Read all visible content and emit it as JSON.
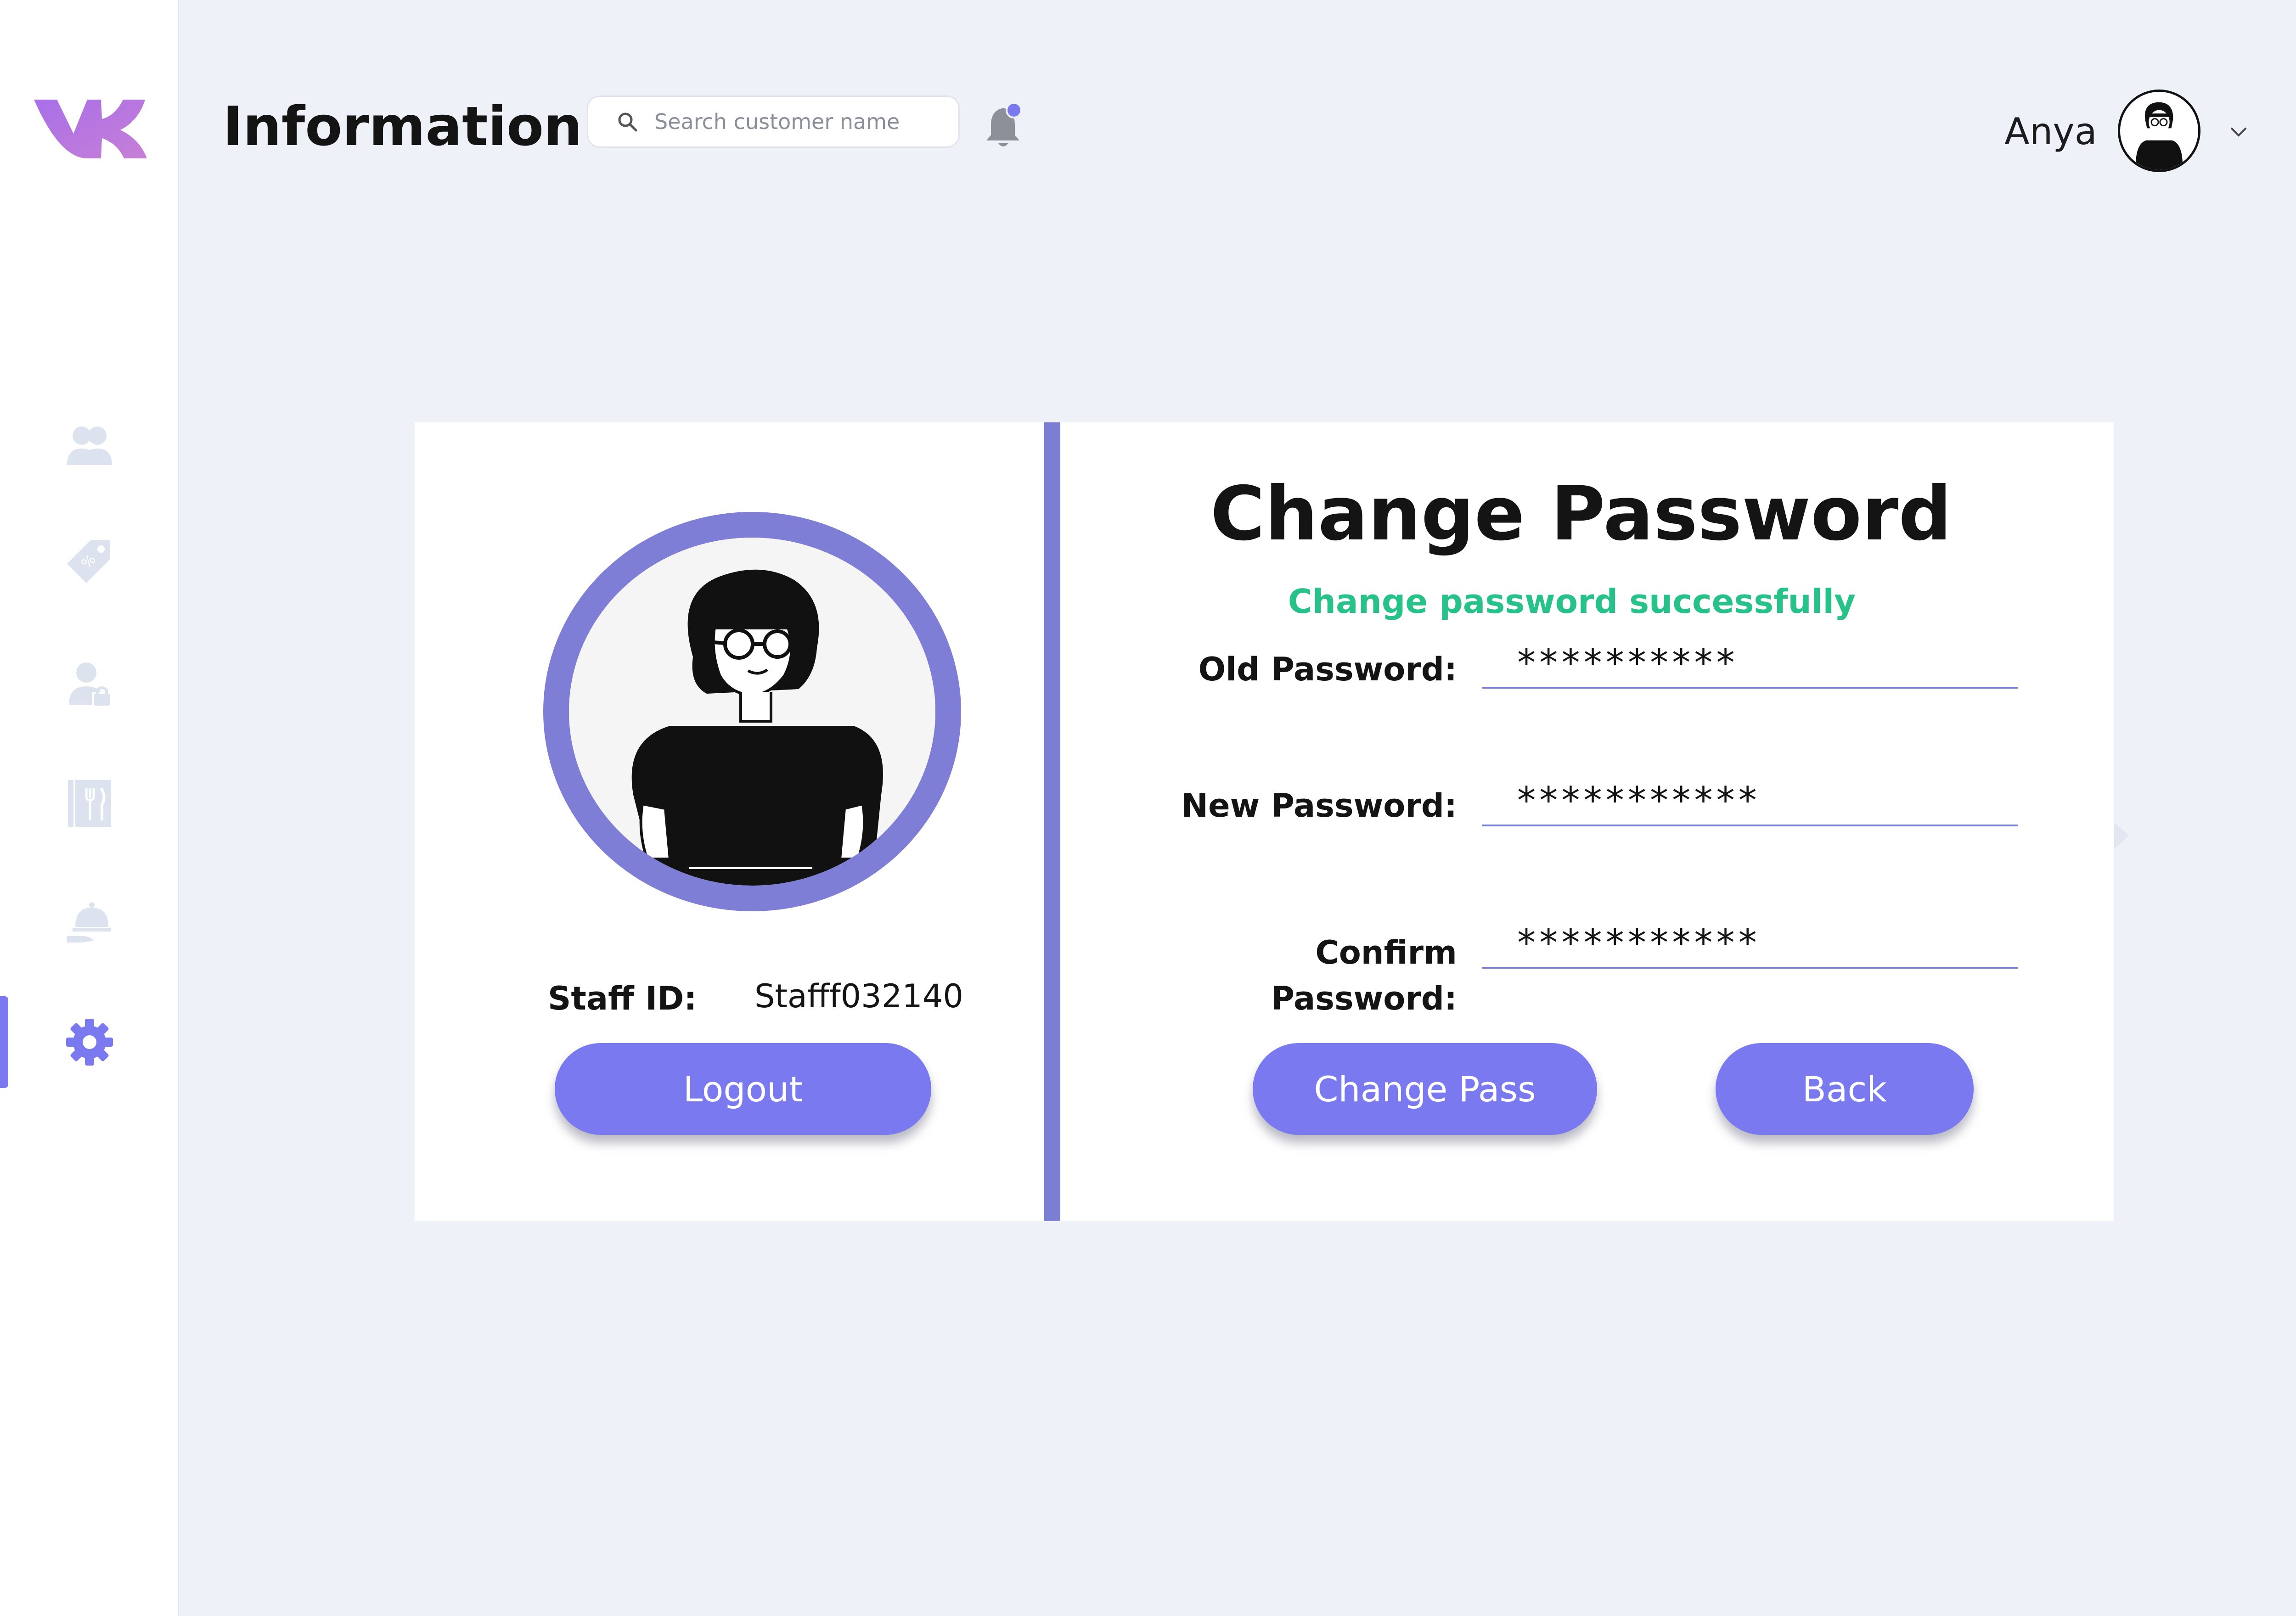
{
  "header": {
    "title": "Information",
    "search_placeholder": "Search customer name",
    "user_name": "Anya"
  },
  "sidebar": {
    "items": [
      {
        "icon": "users-icon",
        "active": false
      },
      {
        "icon": "tag-discount-icon",
        "active": false
      },
      {
        "icon": "user-lock-icon",
        "active": false
      },
      {
        "icon": "menu-utensils-icon",
        "active": false
      },
      {
        "icon": "serving-dish-icon",
        "active": false
      },
      {
        "icon": "gear-icon",
        "active": true
      }
    ]
  },
  "profile": {
    "staff_id_label": "Staff ID:",
    "staff_id_value": "Stafff032140",
    "logout_label": "Logout"
  },
  "change_password": {
    "title": "Change Password",
    "status_message": "Change password successfully",
    "fields": [
      {
        "label": "Old Password:",
        "value": "**********"
      },
      {
        "label": "New Password:",
        "value": "***********"
      },
      {
        "label": "Confirm Password:",
        "value": "***********"
      }
    ],
    "change_label": "Change Pass",
    "back_label": "Back"
  },
  "colors": {
    "accent": "#7b79f0",
    "success": "#27c28a",
    "background": "#eef1f8",
    "divider": "#7b7fd4"
  }
}
